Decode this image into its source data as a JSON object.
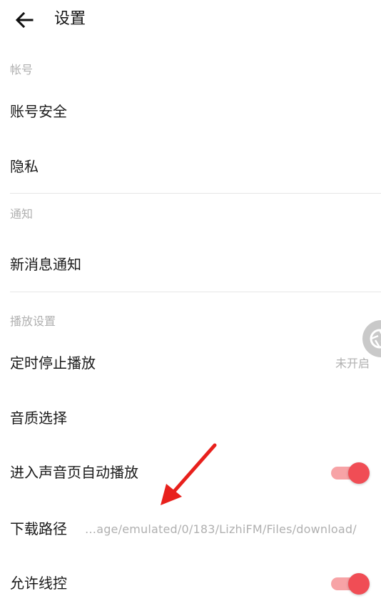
{
  "header": {
    "back_icon": "arrow-left-icon",
    "title": "设置"
  },
  "sections": {
    "account": {
      "header": "帐号",
      "items": {
        "account_security": "账号安全",
        "privacy": "隐私"
      }
    },
    "notification": {
      "header": "通知",
      "items": {
        "new_message": "新消息通知"
      }
    },
    "playback": {
      "header": "播放设置",
      "items": {
        "sleep_timer": {
          "label": "定时停止播放",
          "value": "未开启"
        },
        "audio_quality": {
          "label": "音质选择"
        },
        "autoplay": {
          "label": "进入声音页自动播放",
          "enabled": true
        },
        "download_path": {
          "label": "下载路径",
          "value": "…age/emulated/0/183/LizhiFM/Files/download/"
        },
        "wire_control": {
          "label": "允许线控",
          "enabled": true
        }
      }
    }
  },
  "colors": {
    "accent": "#f04d55",
    "accent_track": "#f7a3a6",
    "secondary_text": "#b0b0b0",
    "annotation_arrow": "#e8201c"
  },
  "floating_button_icon": "aperture-icon",
  "annotation_icon": "red-arrow-icon"
}
